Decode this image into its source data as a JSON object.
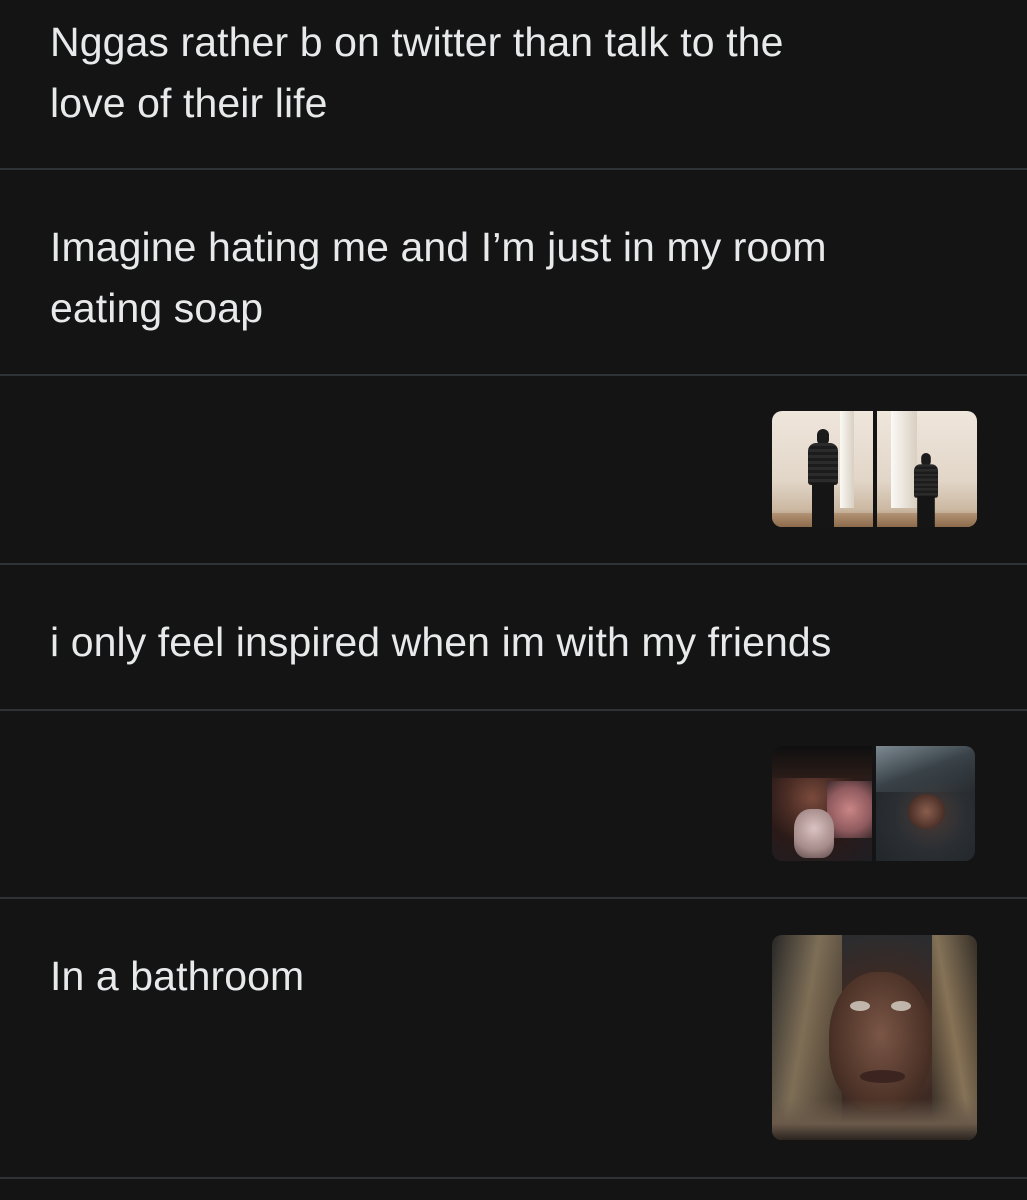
{
  "feed": {
    "rows": [
      {
        "text": "Nggas rather b on twitter than talk to the\nlove of their life"
      },
      {
        "text": "Imagine hating me and I’m just in my room\neating soap"
      },
      {
        "text": "",
        "media": {
          "count": 2,
          "description_icons": [
            "photo-standing-figure",
            "photo-standing-figure"
          ]
        }
      },
      {
        "text": "i only feel inspired when im with my friends"
      },
      {
        "text": "",
        "media": {
          "count": 2,
          "description_icons": [
            "photo-selfie",
            "photo-selfie"
          ]
        }
      },
      {
        "text": "In a bathroom",
        "media": {
          "count": 1,
          "description_icons": [
            "photo-portrait"
          ]
        }
      }
    ]
  },
  "colors": {
    "background": "#141414",
    "text": "#e7e9ea",
    "divider": "#2f3336"
  }
}
